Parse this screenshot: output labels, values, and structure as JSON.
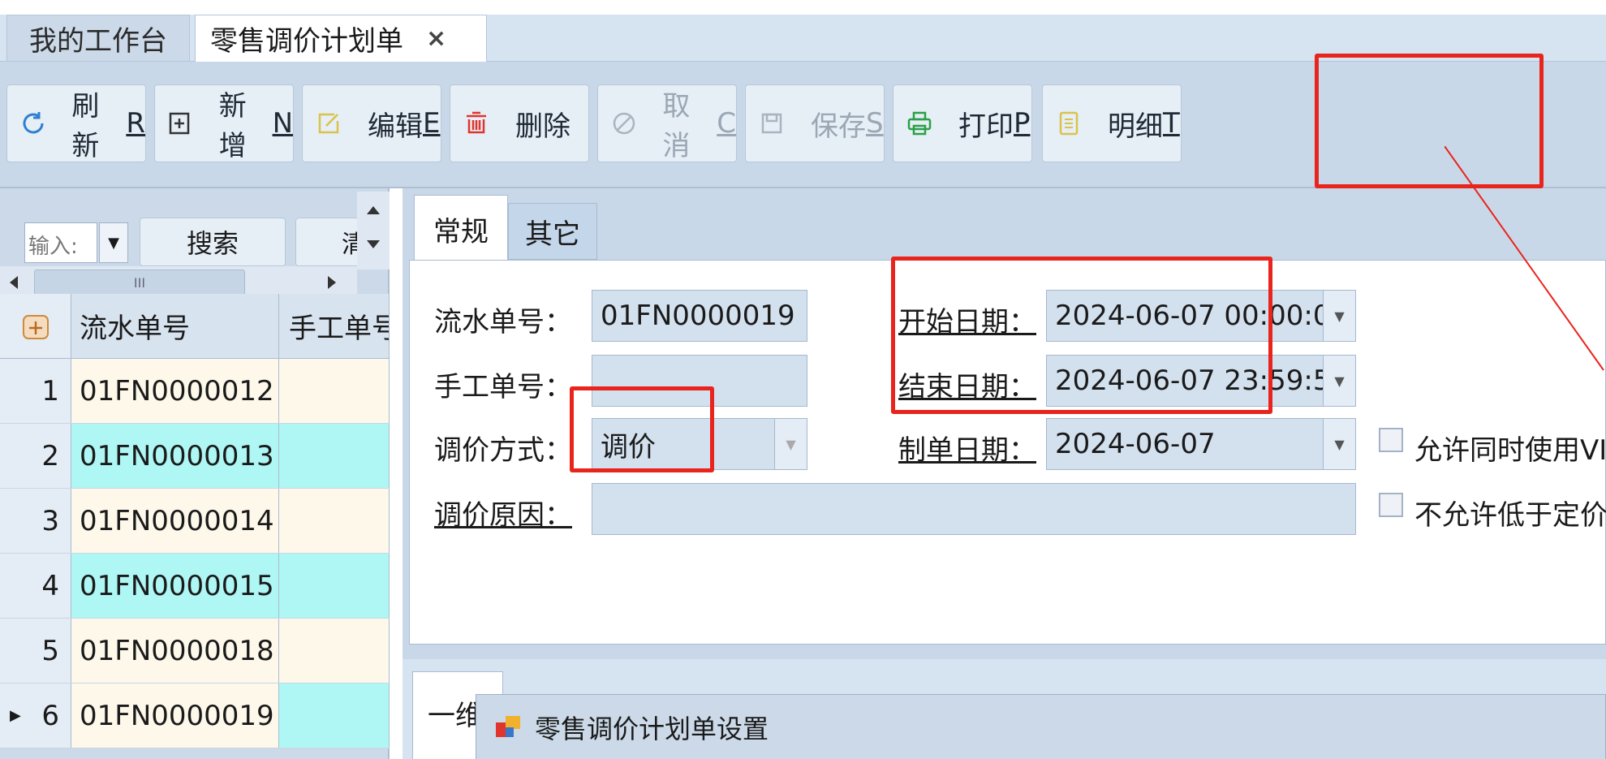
{
  "doc_tabs": [
    {
      "label": "我的工作台"
    },
    {
      "label": "零售调价计划单",
      "close": "×"
    }
  ],
  "toolbar": {
    "buttons": [
      {
        "label": "刷新",
        "key": "R",
        "icon": "refresh-icon",
        "disabled": false
      },
      {
        "label": "新增",
        "key": "N",
        "icon": "add-icon",
        "disabled": false
      },
      {
        "label": "编辑",
        "key": "E",
        "icon": "edit-icon",
        "disabled": false
      },
      {
        "label": "删除",
        "key": "",
        "icon": "delete-icon",
        "disabled": false
      },
      {
        "label": "取消",
        "key": "C",
        "icon": "cancel-icon",
        "disabled": true
      },
      {
        "label": "保存",
        "key": "S",
        "icon": "save-icon",
        "disabled": true
      },
      {
        "label": "打印",
        "key": "P",
        "icon": "print-icon",
        "disabled": false
      },
      {
        "label": "明细",
        "key": "T",
        "icon": "detail-icon",
        "disabled": false
      }
    ]
  },
  "left": {
    "search_input_value": "输入:",
    "search_button": "搜索",
    "cut_button": "清",
    "scroll_thumb_grip": "III",
    "columns": [
      "流水单号",
      "手工单号"
    ],
    "rows": [
      {
        "n": "1",
        "serial": "01FN0000012",
        "manual": ""
      },
      {
        "n": "2",
        "serial": "01FN0000013",
        "manual": ""
      },
      {
        "n": "3",
        "serial": "01FN0000014",
        "manual": ""
      },
      {
        "n": "4",
        "serial": "01FN0000015",
        "manual": ""
      },
      {
        "n": "5",
        "serial": "01FN0000018",
        "manual": ""
      },
      {
        "n": "6",
        "serial": "01FN0000019",
        "manual": "",
        "current": true
      }
    ]
  },
  "form": {
    "tabs": [
      "常规",
      "其它"
    ],
    "fields": {
      "serial_label": "流水单号：",
      "serial_value": "01FN0000019",
      "manual_label": "手工单号：",
      "manual_value": "",
      "method_label": "调价方式：",
      "method_value": "调价",
      "reason_label": "调价原因：",
      "reason_value": "",
      "start_label": "开始日期：",
      "start_value": "2024-06-07 00:00:0",
      "end_label": "结束日期：",
      "end_value": "2024-06-07 23:59:5",
      "made_label": "制单日期：",
      "made_value": "2024-06-07",
      "chk1_label": "允许同时使用VI",
      "chk2_label": "不允许低于定价"
    }
  },
  "lower": {
    "tab_label": "一维",
    "dialog_title": "零售调价计划单设置"
  },
  "colors": {
    "highlight": "#e8241c",
    "row_alt": "#aef7f4",
    "row_base": "#fdf8ea"
  }
}
